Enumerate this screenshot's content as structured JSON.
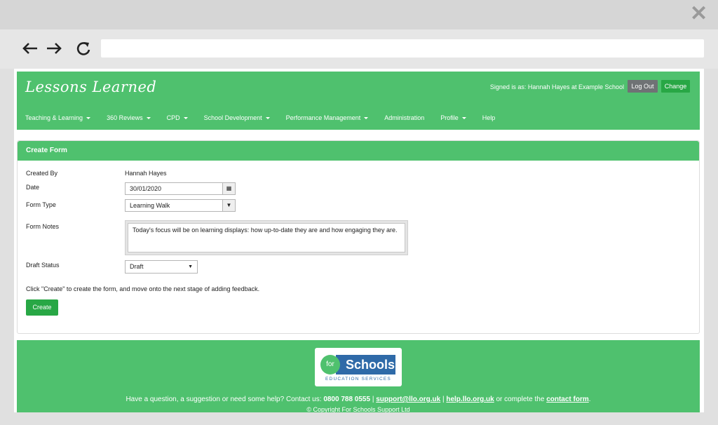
{
  "browser": {
    "close_icon": "close-icon"
  },
  "app": {
    "logo": "Lessons Learned",
    "signed_in": "Signed is as: Hannah Hayes at Example School",
    "logout_label": "Log Out",
    "change_label": "Change",
    "menu": [
      {
        "label": "Teaching & Learning",
        "has_dropdown": true
      },
      {
        "label": "360 Reviews",
        "has_dropdown": true
      },
      {
        "label": "CPD",
        "has_dropdown": true
      },
      {
        "label": "School Development",
        "has_dropdown": true
      },
      {
        "label": "Performance Management",
        "has_dropdown": true
      },
      {
        "label": "Administration",
        "has_dropdown": false
      },
      {
        "label": "Profile",
        "has_dropdown": true
      },
      {
        "label": "Help",
        "has_dropdown": false
      }
    ]
  },
  "form": {
    "title": "Create Form",
    "created_by_label": "Created By",
    "created_by_value": "Hannah Hayes",
    "date_label": "Date",
    "date_value": "30/01/2020",
    "form_type_label": "Form Type",
    "form_type_value": "Learning Walk",
    "notes_label": "Form Notes",
    "notes_value": "Today's focus will be on learning displays: how up-to-date they are and how engaging they are.",
    "draft_label": "Draft Status",
    "draft_value": "Draft",
    "instruction": "Click \"Create\" to create the form, and move onto the next stage of adding feedback.",
    "create_label": "Create"
  },
  "footer": {
    "logo_for": "for",
    "logo_schools": "Schools",
    "logo_sub": "EDUCATION SERVICES",
    "question": "Have a question, a suggestion or need some help? Contact us:",
    "phone": "0800 788 0555",
    "sep1": "|",
    "email": "support@llo.org.uk",
    "sep2": "|",
    "help_link": "help.llo.org.uk",
    "or_text": "or complete the",
    "contact_link": "contact form",
    "period": ".",
    "copyright": "© Copyright For Schools Support Ltd"
  },
  "colors": {
    "primary_green": "#4fc16e",
    "button_green": "#28a745",
    "logout_gray": "#6f7275",
    "brand_blue": "#2f6aa8"
  }
}
